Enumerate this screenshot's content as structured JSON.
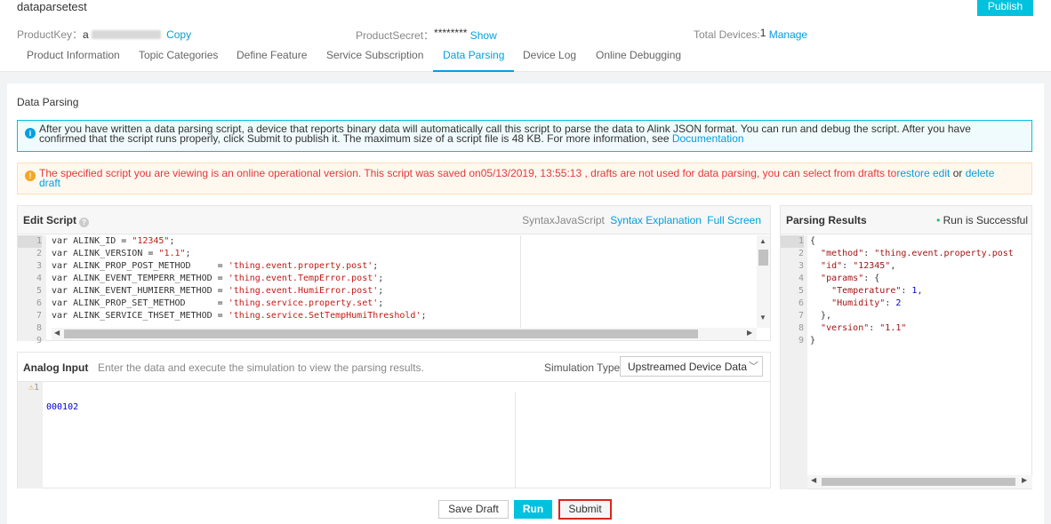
{
  "product": {
    "name": "dataparsetest",
    "publish_label": "Publish",
    "productkey_label": "ProductKey：",
    "productkey_prefix": "a",
    "copy_label": "Copy",
    "productsecret_label": "ProductSecret：",
    "productsecret_value": "********",
    "show_label": "Show",
    "total_devices_label": "Total Devices:",
    "total_devices_value": "1",
    "manage_label": "Manage"
  },
  "tabs": [
    {
      "label": "Product Information"
    },
    {
      "label": "Topic Categories"
    },
    {
      "label": "Define Feature"
    },
    {
      "label": "Service Subscription"
    },
    {
      "label": "Data Parsing",
      "active": true
    },
    {
      "label": "Device Log"
    },
    {
      "label": "Online Debugging"
    }
  ],
  "section_title": "Data Parsing",
  "info": {
    "text": "After you have written a data parsing script, a device that reports binary data will automatically call this script to parse the data to Alink JSON format. You can run and debug the script. After you have confirmed that the script runs properly, click Submit to publish it. The maximum size of a script file is 48 KB. For more information, see",
    "link": "Documentation"
  },
  "warning": {
    "text": "The specified script you are viewing is an online operational version. This script was saved on05/13/2019, 13:55:13 , drafts are not used for data parsing, you can select from drafts to",
    "restore": "restore edit",
    "or": " or ",
    "delete": "delete draft"
  },
  "editor": {
    "title": "Edit Script",
    "syntax_label": "SyntaxJavaScript",
    "syntax_explanation": "Syntax Explanation",
    "full_screen": "Full Screen",
    "lines": [
      {
        "n": "1",
        "a": "var ALINK_ID = ",
        "s": "\"12345\"",
        "e": ";"
      },
      {
        "n": "2",
        "a": "var ALINK_VERSION = ",
        "s": "\"1.1\"",
        "e": ";"
      },
      {
        "n": "3",
        "a": "var ALINK_PROP_POST_METHOD     = ",
        "s": "'thing.event.property.post'",
        "e": ";"
      },
      {
        "n": "4",
        "a": "var ALINK_EVENT_TEMPERR_METHOD = ",
        "s": "'thing.event.TempError.post'",
        "e": ";"
      },
      {
        "n": "5",
        "a": "var ALINK_EVENT_HUMIERR_METHOD = ",
        "s": "'thing.event.HumiError.post'",
        "e": ";"
      },
      {
        "n": "6",
        "a": "var ALINK_PROP_SET_METHOD      = ",
        "s": "'thing.service.property.set'",
        "e": ";"
      },
      {
        "n": "7",
        "a": "var ALINK_SERVICE_THSET_METHOD = ",
        "s": "'thing.service.SetTempHumiThreshold'",
        "e": ";"
      }
    ],
    "extra_line_numbers": [
      "8",
      "9"
    ]
  },
  "analog": {
    "title": "Analog Input",
    "hint": "Enter the data and execute the simulation to view the parsing results.",
    "sim_type_label": "Simulation Type",
    "sim_type_value": "Upstreamed Device Data",
    "line_number": "1",
    "input_value": "000102"
  },
  "results": {
    "title": "Parsing Results",
    "status": "Run is Successful",
    "lines": [
      {
        "n": "1",
        "t": "{"
      },
      {
        "n": "2",
        "t": "  \"method\": \"thing.event.property.post"
      },
      {
        "n": "3",
        "t": "  \"id\": \"12345\","
      },
      {
        "n": "4",
        "t": "  \"params\": {"
      },
      {
        "n": "5",
        "t": "    \"Temperature\": 1,"
      },
      {
        "n": "6",
        "t": "    \"Humidity\": 2"
      },
      {
        "n": "7",
        "t": "  },"
      },
      {
        "n": "8",
        "t": "  \"version\": \"1.1\""
      },
      {
        "n": "9",
        "t": "}"
      }
    ]
  },
  "actions": {
    "save_draft": "Save Draft",
    "run": "Run",
    "submit": "Submit"
  },
  "colors": {
    "accent": "#00c1de",
    "link": "#00a0e0",
    "error": "#e4393c",
    "submit_highlight": "#e4393c"
  }
}
